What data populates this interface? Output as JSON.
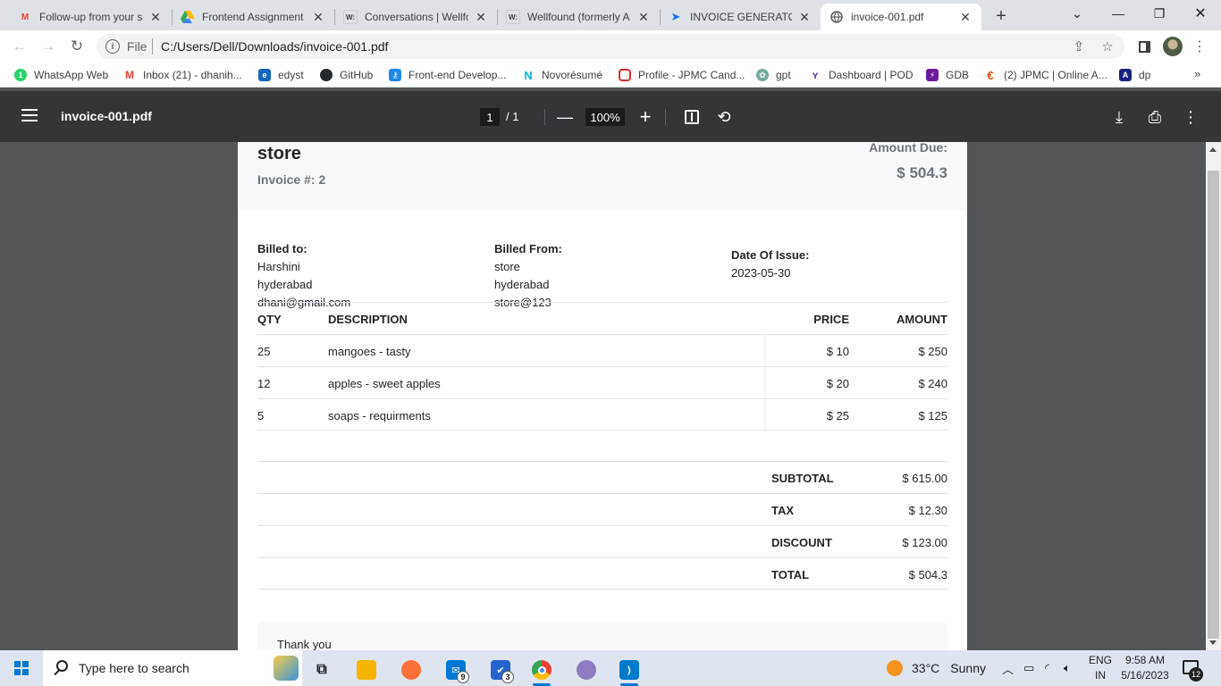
{
  "browser": {
    "tabs": [
      {
        "title": "Follow-up from your s",
        "icon": "gmail-icon",
        "color": "#ea4335"
      },
      {
        "title": "Frontend Assignment",
        "icon": "google-drive-icon",
        "color": "#fbbc04"
      },
      {
        "title": "Conversations | Wellfo",
        "icon": "wellfound-icon",
        "color": "#000000"
      },
      {
        "title": "Wellfound (formerly A",
        "icon": "wellfound-icon",
        "color": "#000000"
      },
      {
        "title": "INVOICE GENERATOR",
        "icon": "send-icon",
        "color": "#1a73e8"
      },
      {
        "title": "invoice-001.pdf",
        "icon": "globe-icon",
        "color": "#5f6368"
      }
    ],
    "omnibox": {
      "scheme": "File",
      "url": "C:/Users/Dell/Downloads/invoice-001.pdf"
    },
    "bookmarks": [
      {
        "label": "WhatsApp Web",
        "color": "#25d366",
        "icon": "whatsapp-icon"
      },
      {
        "label": "Inbox (21) - dhanih...",
        "color": "#ea4335",
        "icon": "gmail-icon"
      },
      {
        "label": "edyst",
        "color": "#1565c0",
        "icon": "edyst-icon"
      },
      {
        "label": "GitHub",
        "color": "#24292e",
        "icon": "github-icon"
      },
      {
        "label": "Front-end Develop...",
        "color": "#1e88e5",
        "icon": "key-icon"
      },
      {
        "label": "Novorésumé",
        "color": "#00b4d8",
        "icon": "novoresume-icon"
      },
      {
        "label": "Profile - JPMC Cand...",
        "color": "#d32f2f",
        "icon": "oracle-icon"
      },
      {
        "label": "gpt",
        "color": "#74aa9c",
        "icon": "openai-icon"
      },
      {
        "label": "Dashboard | POD",
        "color": "#5e35b1",
        "icon": "pod-icon"
      },
      {
        "label": "GDB",
        "color": "#6a1b9a",
        "icon": "gdb-icon"
      },
      {
        "label": "(2) JPMC | Online A...",
        "color": "#e65100",
        "icon": "hackerrank-icon"
      },
      {
        "label": "dp",
        "color": "#1a237e",
        "icon": "dp-icon"
      }
    ]
  },
  "pdf_viewer": {
    "filename": "invoice-001.pdf",
    "page_current": "1",
    "page_total": "/ 1",
    "zoom": "100%"
  },
  "invoice": {
    "store": "store",
    "invoice_number": "Invoice #: 2",
    "amount_due_label": "Amount Due:",
    "amount_due": "$ 504.3",
    "billed_to": {
      "label": "Billed to:",
      "name": "Harshini",
      "city": "hyderabad",
      "email": "dhani@gmail.com"
    },
    "billed_from": {
      "label": "Billed From:",
      "name": "store",
      "city": "hyderabad",
      "email": "store@123"
    },
    "date": {
      "label": "Date Of Issue:",
      "value": "2023-05-30"
    },
    "columns": {
      "qty": "QTY",
      "description": "DESCRIPTION",
      "price": "PRICE",
      "amount": "AMOUNT"
    },
    "items": [
      {
        "qty": "25",
        "description": "mangoes - tasty",
        "price": "$ 10",
        "amount": "$ 250"
      },
      {
        "qty": "12",
        "description": "apples - sweet apples",
        "price": "$ 20",
        "amount": "$ 240"
      },
      {
        "qty": "5",
        "description": "soaps - requirments",
        "price": "$ 25",
        "amount": "$ 125"
      }
    ],
    "totals": [
      {
        "label": "SUBTOTAL",
        "value": "$ 615.00"
      },
      {
        "label": "TAX",
        "value": "$ 12.30"
      },
      {
        "label": "DISCOUNT",
        "value": "$ 123.00"
      },
      {
        "label": "TOTAL",
        "value": "$ 504.3"
      }
    ],
    "note": "Thank you"
  },
  "taskbar": {
    "search_placeholder": "Type here to search",
    "apps": [
      {
        "name": "task-view-icon",
        "color": "#202020",
        "badge": ""
      },
      {
        "name": "file-explorer-icon",
        "color": "#f4b400",
        "badge": ""
      },
      {
        "name": "firefox-icon",
        "color": "#ff7139",
        "badge": ""
      },
      {
        "name": "mail-icon",
        "color": "#0078d4",
        "badge": "9"
      },
      {
        "name": "todo-icon",
        "color": "#2564cf",
        "badge": "3"
      },
      {
        "name": "chrome-icon",
        "color": "#34a853",
        "badge": ""
      },
      {
        "name": "paint-icon",
        "color": "#8e7cc3",
        "badge": ""
      },
      {
        "name": "vscode-icon",
        "color": "#007acc",
        "badge": ""
      }
    ],
    "weather": {
      "temp": "33°C",
      "condition": "Sunny"
    },
    "language": {
      "top": "ENG",
      "bottom": "IN"
    },
    "clock": {
      "time": "9:58 AM",
      "date": "5/16/2023"
    },
    "notifications": "12"
  }
}
